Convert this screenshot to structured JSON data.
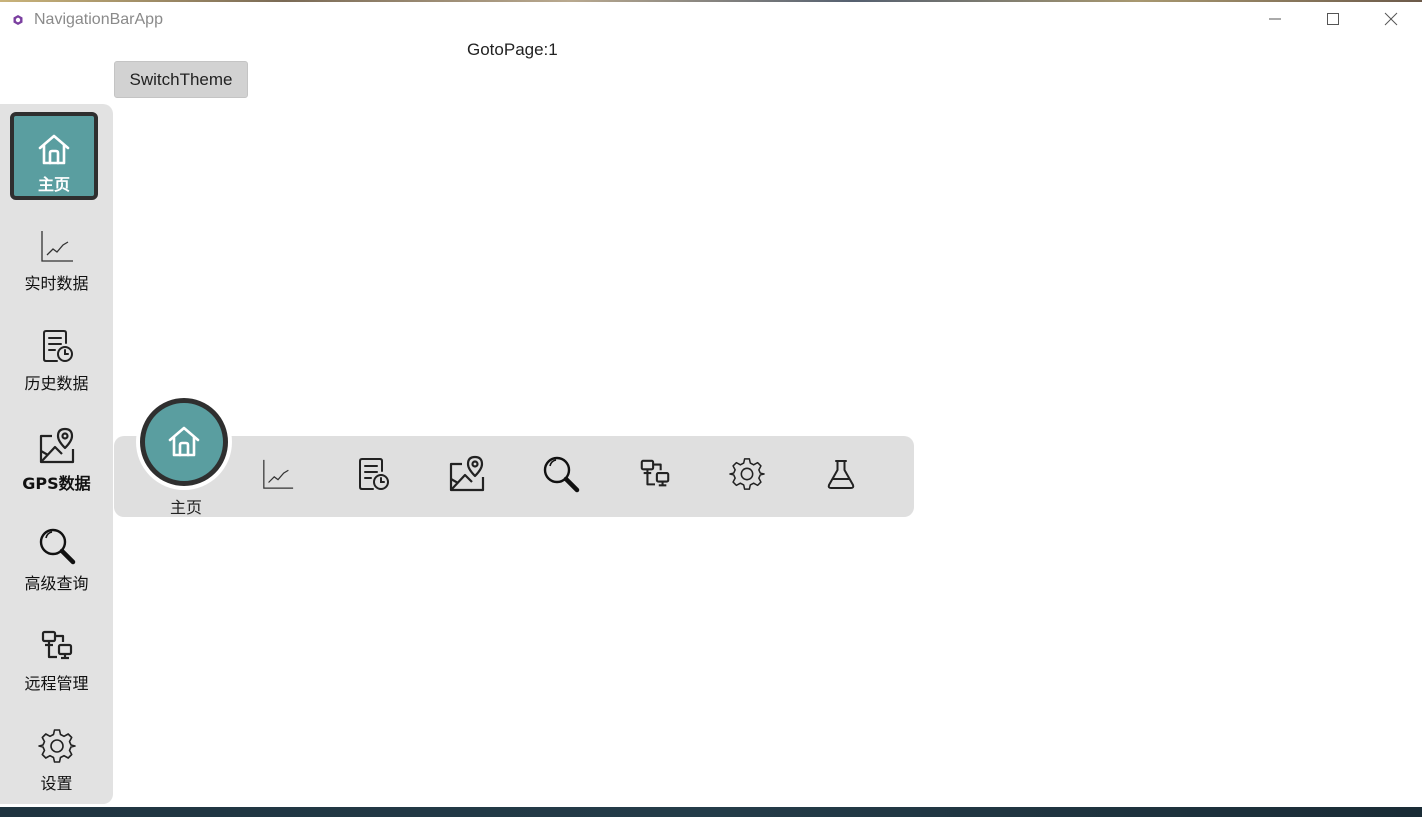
{
  "window": {
    "title": "NavigationBarApp",
    "controls": [
      "minimize-icon",
      "maximize-icon",
      "close-icon"
    ],
    "app_icon_color": "#7b3fa0"
  },
  "header": {
    "goto_text": "GotoPage:1",
    "switch_theme_label": "SwitchTheme"
  },
  "colors": {
    "accent": "#5a9ea0",
    "active_border": "#2f2f2f",
    "bar_bg": "#e2e2e2"
  },
  "sidebar": {
    "items": [
      {
        "label": "主页",
        "icon": "home-icon",
        "active": true
      },
      {
        "label": "实时数据",
        "icon": "chart-line-icon"
      },
      {
        "label": "历史数据",
        "icon": "history-doc-icon"
      },
      {
        "label": "GPS数据",
        "icon": "map-pin-icon"
      },
      {
        "label": "高级查询",
        "icon": "search-icon"
      },
      {
        "label": "远程管理",
        "icon": "remote-network-icon"
      },
      {
        "label": "设置",
        "icon": "gear-icon"
      }
    ]
  },
  "bottombar": {
    "active_label": "主页",
    "items": [
      {
        "icon": "home-icon",
        "active": true
      },
      {
        "icon": "chart-line-icon"
      },
      {
        "icon": "history-doc-icon"
      },
      {
        "icon": "map-pin-icon"
      },
      {
        "icon": "search-icon"
      },
      {
        "icon": "remote-network-icon"
      },
      {
        "icon": "gear-icon"
      },
      {
        "icon": "flask-icon"
      }
    ]
  }
}
